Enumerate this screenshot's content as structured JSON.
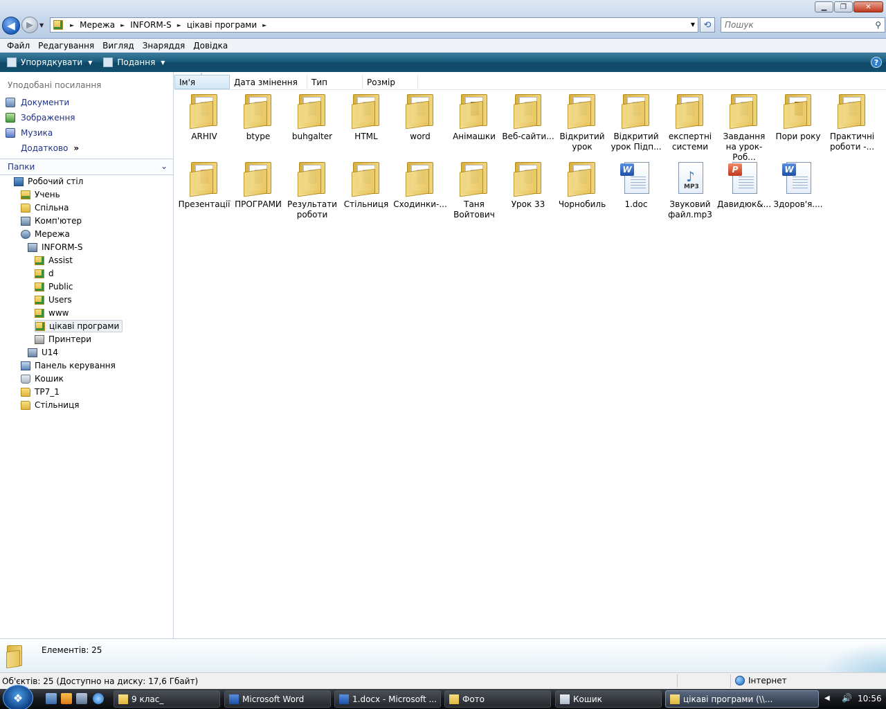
{
  "window": {
    "minimize_symbol": "▁",
    "maximize_symbol": "❐",
    "close_symbol": "✕"
  },
  "nav": {
    "back_symbol": "◀",
    "forward_symbol": "▶",
    "dropdown_symbol": "▼"
  },
  "address": {
    "crumbs": [
      "Мережа",
      "INFORM-S",
      "цікаві програми"
    ],
    "separator": "►",
    "dropdown_symbol": "▼"
  },
  "search": {
    "placeholder": "Пошук",
    "icon": "search-icon"
  },
  "menu": {
    "items": [
      "Файл",
      "Редагування",
      "Вигляд",
      "Знаряддя",
      "Довідка"
    ]
  },
  "toolbar": {
    "organize_label": "Упорядкувати",
    "views_label": "Подання",
    "help_label": "?",
    "arrow": "▼"
  },
  "sidebar": {
    "favorites_title": "Уподобані посилання",
    "favorites": [
      {
        "label": "Документи",
        "icon": "documents-icon"
      },
      {
        "label": "Зображення",
        "icon": "pictures-icon"
      },
      {
        "label": "Музика",
        "icon": "music-icon"
      }
    ],
    "more_label": "Додатково",
    "more_symbol": "»",
    "folders_title": "Папки",
    "folders_chevron": "⌄",
    "tree": [
      {
        "label": "Робочий стіл",
        "icon": "desktop-icon",
        "level": 0
      },
      {
        "label": "Учень",
        "icon": "user-folder-icon",
        "level": 1
      },
      {
        "label": "Спільна",
        "icon": "folder-icon",
        "level": 1
      },
      {
        "label": "Комп'ютер",
        "icon": "computer-icon",
        "level": 1
      },
      {
        "label": "Мережа",
        "icon": "network-icon",
        "level": 1
      },
      {
        "label": "INFORM-S",
        "icon": "computer-icon",
        "level": 2
      },
      {
        "label": "Assist",
        "icon": "shared-folder-icon",
        "level": 3
      },
      {
        "label": "d",
        "icon": "shared-folder-icon",
        "level": 3
      },
      {
        "label": "Public",
        "icon": "shared-folder-icon",
        "level": 3
      },
      {
        "label": "Users",
        "icon": "shared-folder-icon",
        "level": 3
      },
      {
        "label": "www",
        "icon": "shared-folder-icon",
        "level": 3
      },
      {
        "label": "цікаві програми",
        "icon": "shared-folder-icon",
        "level": 3,
        "selected": true
      },
      {
        "label": "Принтери",
        "icon": "printer-icon",
        "level": 3
      },
      {
        "label": "U14",
        "icon": "computer-icon",
        "level": 2
      },
      {
        "label": "Панель керування",
        "icon": "control-panel-icon",
        "level": 1
      },
      {
        "label": "Кошик",
        "icon": "recycle-bin-icon",
        "level": 1
      },
      {
        "label": "ТР7_1",
        "icon": "folder-icon",
        "level": 1
      },
      {
        "label": "Стільниця",
        "icon": "folder-icon",
        "level": 1
      }
    ]
  },
  "columns": {
    "headers": [
      "Ім'я",
      "Дата змінення",
      "Тип",
      "Розмір"
    ],
    "sort_symbol": "˄"
  },
  "files": [
    {
      "label": "ARHIV",
      "type": "folder"
    },
    {
      "label": "btype",
      "type": "folder"
    },
    {
      "label": "buhgalter",
      "type": "folder"
    },
    {
      "label": "HTML",
      "type": "folder"
    },
    {
      "label": "word",
      "type": "folder"
    },
    {
      "label": "Анімашки",
      "type": "folder-photo"
    },
    {
      "label": "Веб-сайти...",
      "type": "folder"
    },
    {
      "label": "Відкритий урок",
      "type": "folder"
    },
    {
      "label": "Відкритий урок Підп...",
      "type": "folder"
    },
    {
      "label": "експертні системи",
      "type": "folder"
    },
    {
      "label": "Завдання на урок- Роб...",
      "type": "folder"
    },
    {
      "label": "Пори року",
      "type": "folder-dark"
    },
    {
      "label": "Практичні роботи -...",
      "type": "folder"
    },
    {
      "label": "Презентації",
      "type": "folder-pink"
    },
    {
      "label": "ПРОГРАМИ",
      "type": "folder"
    },
    {
      "label": "Результати роботи",
      "type": "folder"
    },
    {
      "label": "Стільниця",
      "type": "folder"
    },
    {
      "label": "Сходинки-...",
      "type": "folder"
    },
    {
      "label": "Таня Войтович",
      "type": "folder"
    },
    {
      "label": "Урок 33",
      "type": "folder"
    },
    {
      "label": "Чорнобиль",
      "type": "folder"
    },
    {
      "label": "1.doc",
      "type": "word"
    },
    {
      "label": "Звуковий файл.mp3",
      "type": "mp3"
    },
    {
      "label": "Давидюк&...",
      "type": "powerpoint"
    },
    {
      "label": "Здоров'я....",
      "type": "word"
    }
  ],
  "file_badges": {
    "word": "W",
    "powerpoint": "P",
    "mp3_note": "♪",
    "mp3_text": "MP3"
  },
  "details": {
    "count_label": "Елементів: 25"
  },
  "status": {
    "left": "Об'єктів: 25 (Доступно на диску: 17,6 Гбайт)",
    "zone": "Інтернет"
  },
  "taskbar": {
    "start_symbol": "❖",
    "tasks": [
      {
        "label": "9 клас_",
        "icon": "folder-icon"
      },
      {
        "label": "Microsoft Word",
        "icon": "word-icon"
      },
      {
        "label": "1.docx - Microsoft ...",
        "icon": "word-icon"
      },
      {
        "label": "Фото",
        "icon": "folder-icon"
      },
      {
        "label": "Кошик",
        "icon": "recycle-bin-icon"
      },
      {
        "label": "цікаві програми (\\\\...",
        "icon": "folder-icon",
        "active": true
      }
    ],
    "tray_arrow": "◀",
    "volume_symbol": "🔊",
    "clock": "10:56"
  }
}
